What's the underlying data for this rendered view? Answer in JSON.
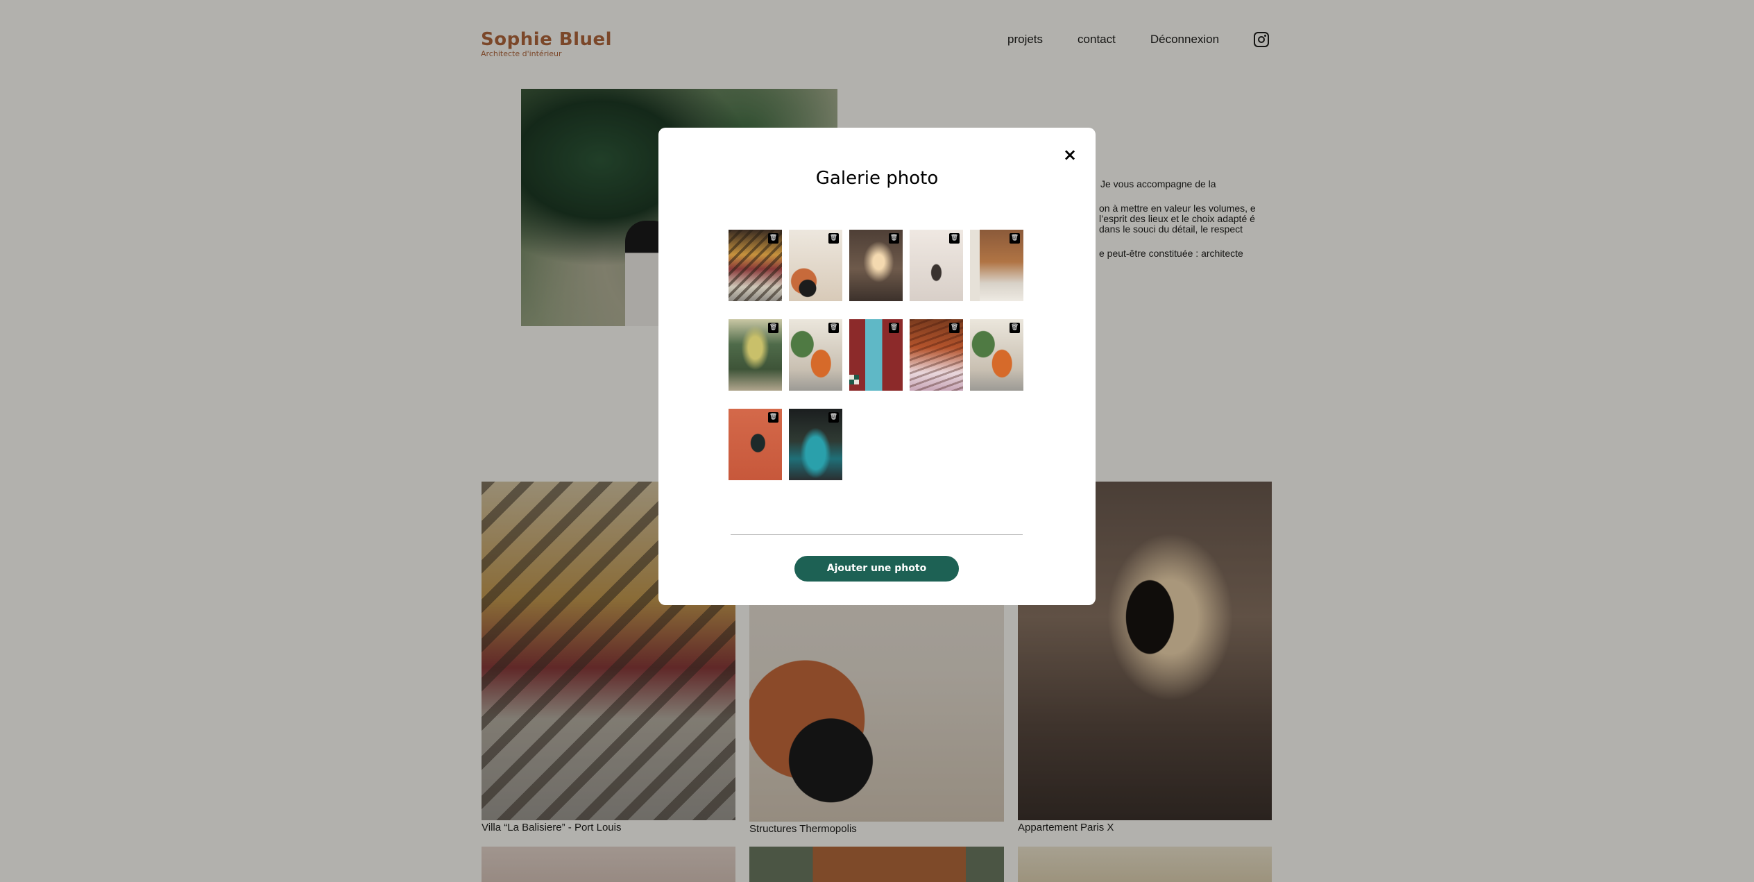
{
  "header": {
    "logo_title": "Sophie Bluel",
    "logo_subtitle": "Architecte d'intérieur",
    "nav": [
      "projets",
      "contact",
      "Déconnexion"
    ],
    "instagram_icon": "instagram-icon"
  },
  "intro": {
    "paragraphs": [
      "Je vous accompagne de la",
      "on à mettre en valeur les volumes, e l’esprit des lieux et le choix adapté é dans le souci du détail, le respect",
      "e peut-être constituée : architecte"
    ]
  },
  "gallery": {
    "captions": [
      "Villa “La Balisiere” - Port Louis",
      "Structures Thermopolis",
      "Appartement Paris X"
    ]
  },
  "modal": {
    "title": "Galerie photo",
    "close_icon": "close-icon",
    "delete_icon": "trash-icon",
    "add_button": "Ajouter une photo",
    "thumbnail_count": 12
  },
  "colors": {
    "brand": "#B1663C",
    "button": "#1D6154",
    "background": "#FFFEF8"
  }
}
